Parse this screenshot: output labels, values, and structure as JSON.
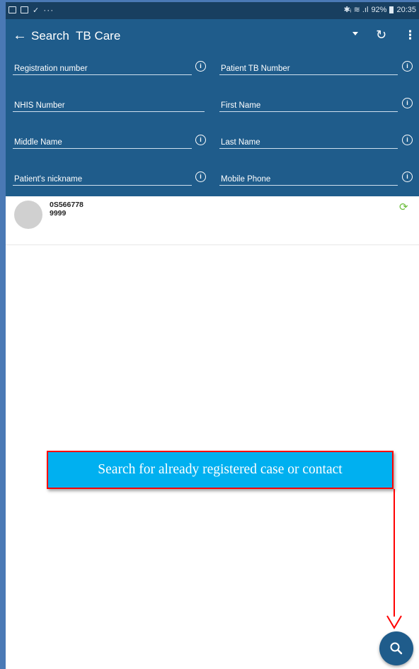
{
  "status_bar": {
    "left_icons": [
      "image-icon",
      "mail-icon",
      "check-icon",
      "more-icon"
    ],
    "dots": "···",
    "signal_text": "✱ᵢ ≋ .ıl",
    "battery_percent": "92%",
    "time": "20:35"
  },
  "toolbar": {
    "back_icon": "←",
    "title": "Search  TB Care",
    "refresh_icon": "↻",
    "menu_icon": "⋮"
  },
  "fields": [
    {
      "label": "Registration number",
      "has_info": true
    },
    {
      "label": "Patient TB Number",
      "has_info": true
    },
    {
      "label": "NHIS Number",
      "has_info": false
    },
    {
      "label": "First Name",
      "has_info": true
    },
    {
      "label": "Middle Name",
      "has_info": true
    },
    {
      "label": "Last Name",
      "has_info": true
    },
    {
      "label": "Patient's nickname",
      "has_info": true
    },
    {
      "label": "Mobile Phone",
      "has_info": true
    }
  ],
  "info_glyph": "i",
  "results": [
    {
      "line1": "0S566778",
      "line2": "9999"
    }
  ],
  "annotation": {
    "text": "Search for already registered case or contact"
  },
  "colors": {
    "app_bar": "#1f5c8b",
    "status_bar": "#183f60",
    "sync_icon": "#6bbd3a",
    "callout_fill": "#00b0f0",
    "callout_border": "#ff0000"
  }
}
